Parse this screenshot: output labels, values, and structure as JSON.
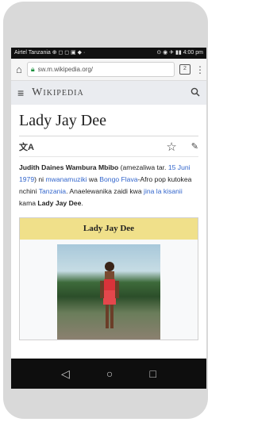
{
  "status_bar": {
    "left_text": "Airtel Tanzania ⊕ ◻ ◻ ▣ ◆ ·",
    "right_text": "⊙ ◉ ✈ ▮▮ 4:00 pm"
  },
  "browser": {
    "url": "sw.m.wikipedia.org/",
    "tabs_count": "2"
  },
  "wiki_header": {
    "wordmark": "Wikipedia"
  },
  "article": {
    "title": "Lady Jay Dee",
    "lead_parts": {
      "name_bold": "Judith Daines Wambura Mbibo",
      "t1": " (amezaliwa tar. ",
      "link_date": "15 Juni 1979",
      "t2": ") ni ",
      "link_musician": "mwanamuziki",
      "t3": " wa ",
      "link_bongo": "Bongo Flava",
      "t4": "-Afro pop kutokea nchini ",
      "link_tanzania": "Tanzania",
      "t5": ". Anaelewanika zaidi kwa ",
      "link_stage": "jina la kisanii",
      "t6": " kama ",
      "stage_bold": "Lady Jay Dee",
      "t7": "."
    }
  },
  "infobox": {
    "title": "Lady Jay Dee"
  },
  "colors": {
    "link": "#3366cc",
    "infobox_header": "#f0e08a",
    "wiki_header_bg": "#eaecf0"
  }
}
